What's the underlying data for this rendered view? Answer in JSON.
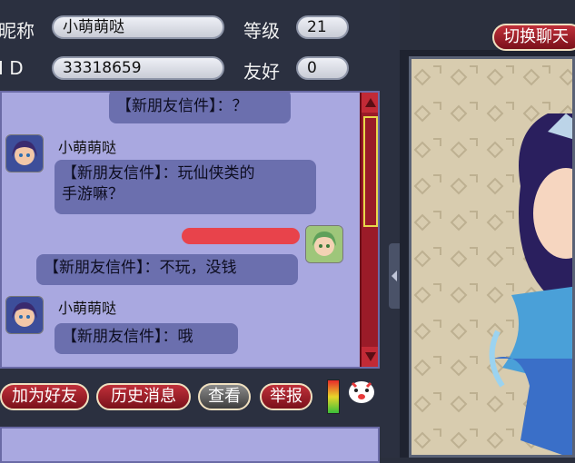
{
  "profile": {
    "nickname_label": "昵称",
    "nickname_value": "小萌萌哒",
    "level_label": "等级",
    "level_value": "21",
    "id_label": "I D",
    "id_value": "33318659",
    "friendship_label": "友好",
    "friendship_value": "0"
  },
  "header": {
    "switch_button": "切换聊天"
  },
  "chat": {
    "partial_top_message": "【新朋友信件】：？",
    "messages": [
      {
        "sender": "小萌萌哒",
        "text_line1": "【新朋友信件】：玩仙侠类的",
        "text_line2": "手游嘛？"
      },
      {
        "sender": "",
        "text": "【新朋友信件】：不玩，没钱"
      },
      {
        "sender": "小萌萌哒",
        "text": "【新朋友信件】：哦"
      }
    ]
  },
  "buttons": {
    "add_friend": "加为好友",
    "history": "历史消息",
    "view": "查看",
    "report": "举报"
  },
  "colors": {
    "chat_bg": "#a9a8e0",
    "bubble_bg": "#6b6fae",
    "button_red": "#9a1b28",
    "redaction": "#e8434b"
  }
}
